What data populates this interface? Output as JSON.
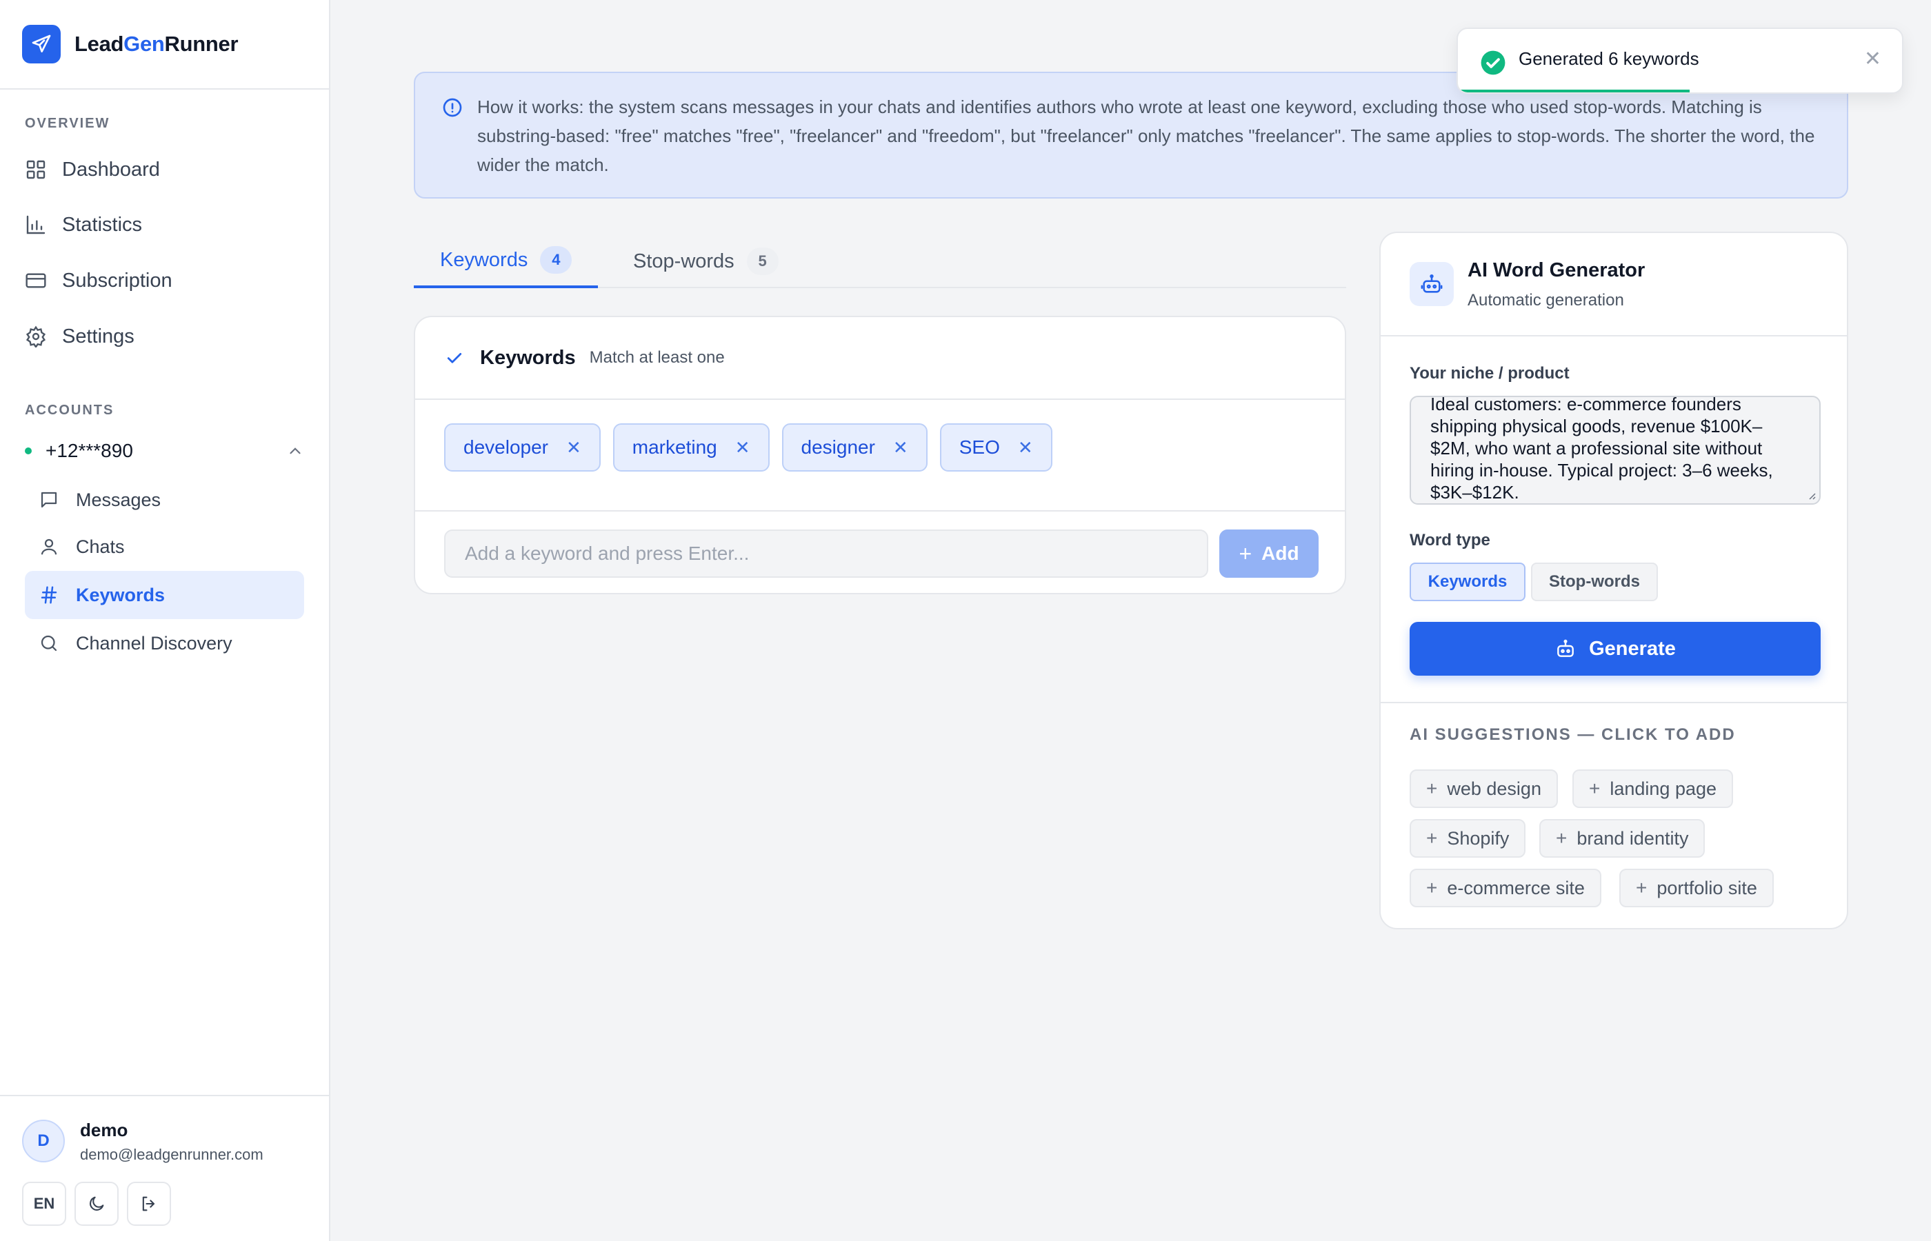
{
  "app": {
    "name_part1": "Lead",
    "name_part2": "Gen",
    "name_part3": "Runner"
  },
  "sidebar": {
    "overview_title": "OVERVIEW",
    "nav": [
      {
        "label": "Dashboard",
        "icon": "grid-icon"
      },
      {
        "label": "Statistics",
        "icon": "bar-chart-icon"
      },
      {
        "label": "Subscription",
        "icon": "credit-card-icon"
      },
      {
        "label": "Settings",
        "icon": "gear-icon"
      }
    ],
    "accounts_title": "ACCOUNTS",
    "account": "+12***890",
    "account_items": [
      {
        "label": "Messages",
        "icon": "message-icon"
      },
      {
        "label": "Chats",
        "icon": "user-icon"
      },
      {
        "label": "Keywords",
        "icon": "hash-icon"
      },
      {
        "label": "Channel Discovery",
        "icon": "search-icon"
      }
    ],
    "user": {
      "initial": "D",
      "name": "demo",
      "email": "demo@leadgenrunner.com"
    },
    "lang": "EN"
  },
  "banner": {
    "text": "How it works: the system scans messages in your chats and identifies authors who wrote at least one keyword, excluding those who used stop-words. Matching is substring-based: \"free\" matches \"free\", \"freelancer\" and \"freedom\", but \"freelancer\" only matches \"freelancer\". The same applies to stop-words. The shorter the word, the wider the match."
  },
  "tabs": [
    {
      "label": "Keywords",
      "count": "4"
    },
    {
      "label": "Stop-words",
      "count": "5"
    }
  ],
  "keywords_card": {
    "title": "Keywords",
    "subtitle": "Match at least one",
    "chips": [
      "developer",
      "marketing",
      "designer",
      "SEO"
    ],
    "input_placeholder": "Add a keyword and press Enter...",
    "add_label": "Add"
  },
  "ai": {
    "title": "AI Word Generator",
    "subtitle": "Automatic generation",
    "niche_label": "Your niche / product",
    "niche_value": "Ideal customers: e-commerce founders shipping physical goods, revenue $100K–$2M, who want a professional site without hiring in-house. Typical project: 3–6 weeks, $3K–$12K.",
    "word_type_label": "Word type",
    "type_keywords": "Keywords",
    "type_stopwords": "Stop-words",
    "generate_label": "Generate",
    "suggestions_title": "AI SUGGESTIONS — CLICK TO ADD",
    "suggestions": [
      "web design",
      "landing page",
      "Shopify",
      "brand identity",
      "e-commerce site",
      "portfolio site"
    ]
  },
  "toast": {
    "text": "Generated 6 keywords"
  },
  "colors": {
    "accent": "#2563eb",
    "success": "#10b981",
    "banner_bg": "#e2e9fb"
  }
}
